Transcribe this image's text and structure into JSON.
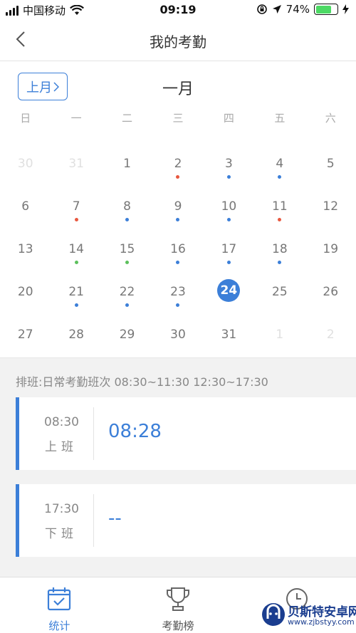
{
  "status_bar": {
    "carrier": "中国移动",
    "time": "09:19",
    "battery": "74%",
    "battery_level": 0.74
  },
  "nav": {
    "title": "我的考勤"
  },
  "calendar": {
    "prev_month_label": "上月",
    "month_title": "一月",
    "weekdays": [
      "日",
      "一",
      "二",
      "三",
      "四",
      "五",
      "六"
    ],
    "weeks": [
      [
        {
          "d": "30",
          "other": true
        },
        {
          "d": "31",
          "other": true
        },
        {
          "d": "1"
        },
        {
          "d": "2",
          "dot": "red"
        },
        {
          "d": "3",
          "dot": "blue"
        },
        {
          "d": "4",
          "dot": "blue"
        },
        {
          "d": "5"
        }
      ],
      [
        {
          "d": "6"
        },
        {
          "d": "7",
          "dot": "red"
        },
        {
          "d": "8",
          "dot": "blue"
        },
        {
          "d": "9",
          "dot": "blue"
        },
        {
          "d": "10",
          "dot": "blue"
        },
        {
          "d": "11",
          "dot": "red"
        },
        {
          "d": "12"
        }
      ],
      [
        {
          "d": "13"
        },
        {
          "d": "14",
          "dot": "green"
        },
        {
          "d": "15",
          "dot": "green"
        },
        {
          "d": "16",
          "dot": "blue"
        },
        {
          "d": "17",
          "dot": "blue"
        },
        {
          "d": "18",
          "dot": "blue"
        },
        {
          "d": "19"
        }
      ],
      [
        {
          "d": "20"
        },
        {
          "d": "21",
          "dot": "blue"
        },
        {
          "d": "22",
          "dot": "blue"
        },
        {
          "d": "23",
          "dot": "blue"
        },
        {
          "d": "24",
          "today": true
        },
        {
          "d": "25"
        },
        {
          "d": "26"
        }
      ],
      [
        {
          "d": "27"
        },
        {
          "d": "28"
        },
        {
          "d": "29"
        },
        {
          "d": "30"
        },
        {
          "d": "31"
        },
        {
          "d": "1",
          "other": true
        },
        {
          "d": "2",
          "other": true
        }
      ]
    ]
  },
  "colors": {
    "accent": "#3c7fd8",
    "dot_red": "#e8583f",
    "dot_blue": "#3c7fd8",
    "dot_green": "#5cc05c"
  },
  "schedule": {
    "text": "排班:日常考勤班次 08:30~11:30 12:30~17:30"
  },
  "punches": [
    {
      "time": "08:30",
      "label": "上班",
      "value": "08:28"
    },
    {
      "time": "17:30",
      "label": "下班",
      "value": "--"
    }
  ],
  "tabs": [
    {
      "label": "统计",
      "icon": "calendar-check-icon",
      "active": true
    },
    {
      "label": "考勤榜",
      "icon": "trophy-icon",
      "active": false
    },
    {
      "label": "",
      "icon": "clock-icon",
      "active": false
    }
  ],
  "watermark": {
    "brand": "贝斯特安卓网",
    "url": "www.zjbstyy.com"
  }
}
